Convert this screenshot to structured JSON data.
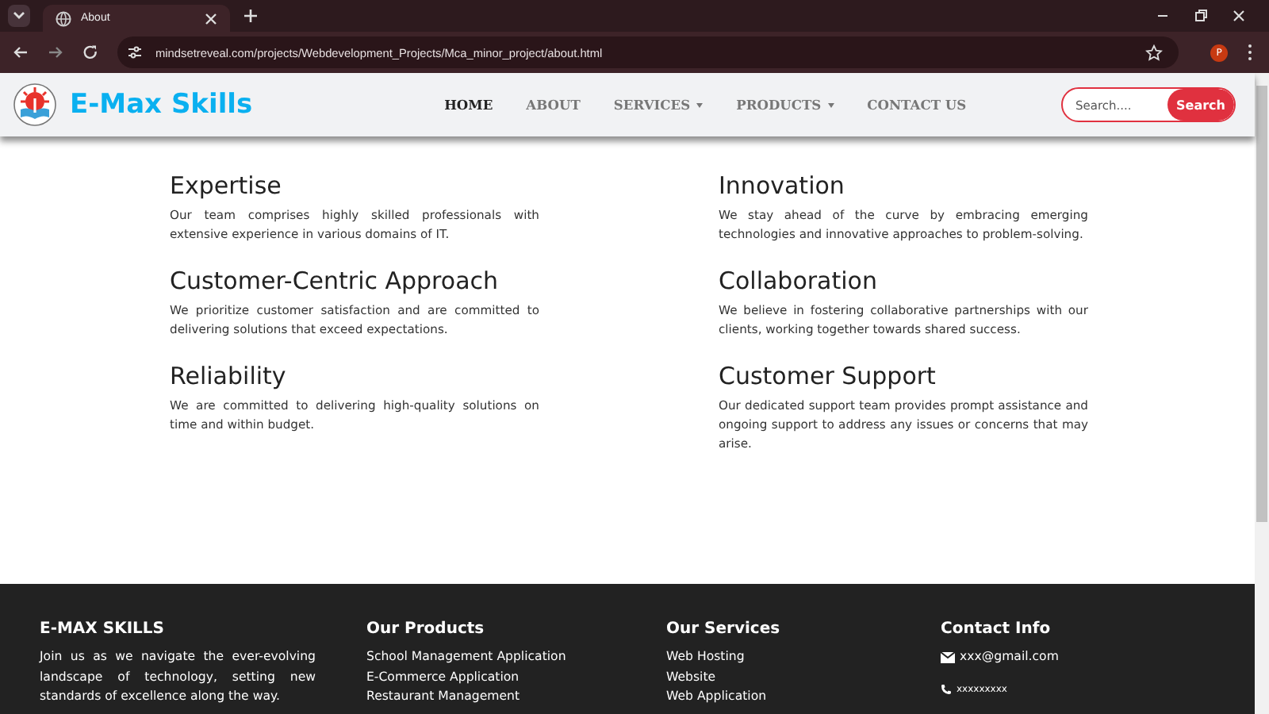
{
  "browser": {
    "tab_title": "About",
    "url": "mindsetreveal.com/projects/Webdevelopment_Projects/Mca_minor_project/about.html",
    "profile_initial": "P"
  },
  "navbar": {
    "brand": "E-Max Skills",
    "links": [
      {
        "label": "HOME",
        "selected": true,
        "dropdown": false
      },
      {
        "label": "ABOUT",
        "selected": false,
        "dropdown": false
      },
      {
        "label": "SERVICES",
        "selected": false,
        "dropdown": true
      },
      {
        "label": "PRODUCTS",
        "selected": false,
        "dropdown": true
      },
      {
        "label": "CONTACT US",
        "selected": false,
        "dropdown": false
      }
    ],
    "search": {
      "placeholder": "Search....",
      "button": "Search"
    }
  },
  "features": [
    {
      "title": "Expertise",
      "text": "Our team comprises highly skilled professionals with extensive experience in various domains of IT."
    },
    {
      "title": "Innovation",
      "text": "We stay ahead of the curve by embracing emerging technologies and innovative approaches to problem-solving."
    },
    {
      "title": "Customer-Centric Approach",
      "text": "We prioritize customer satisfaction and are committed to delivering solutions that exceed expectations."
    },
    {
      "title": "Collaboration",
      "text": "We believe in fostering collaborative partnerships with our clients, working together towards shared success."
    },
    {
      "title": "Reliability",
      "text": "We are committed to delivering high-quality solutions on time and within budget."
    },
    {
      "title": "Customer Support",
      "text": "Our dedicated support team provides prompt assistance and ongoing support to address any issues or concerns that may arise."
    }
  ],
  "footer": {
    "about": {
      "title": "E-MAX SKILLS",
      "text": "Join us as we navigate the ever-evolving landscape of technology, setting new standards of excellence along the way."
    },
    "products": {
      "title": "Our Products",
      "items": [
        "School Management Application",
        "E-Commerce Application",
        "Restaurant Management"
      ]
    },
    "services": {
      "title": "Our Services",
      "items": [
        "Web Hosting",
        "Website",
        "Web Application"
      ]
    },
    "contact": {
      "title": "Contact Info",
      "email": "xxx@gmail.com",
      "phone": "xxxxxxxxx"
    }
  }
}
